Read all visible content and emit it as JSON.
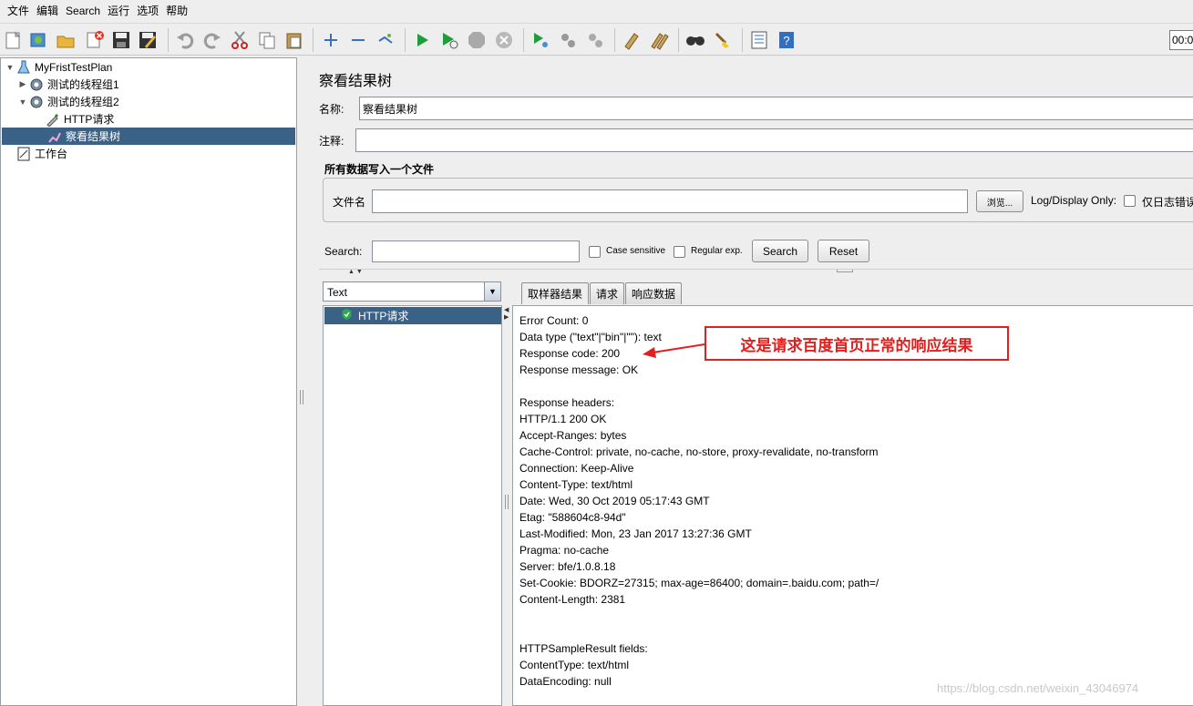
{
  "menu": [
    "文件",
    "编辑",
    "Search",
    "运行",
    "选项",
    "帮助"
  ],
  "toolbar": {
    "icons": [
      "new-icon",
      "templates-icon",
      "open-icon",
      "close-icon",
      "save-icon",
      "save-as-icon",
      "undo-icon",
      "redo-icon",
      "cut-icon",
      "copy-icon",
      "paste-icon",
      "expand-icon",
      "collapse-icon",
      "toggle-icon",
      "start-icon",
      "start-no-pauses-icon",
      "stop-icon",
      "shutdown-icon",
      "remote-start-icon",
      "remote-stop-icon",
      "remote-shutdown-icon",
      "clear-icon",
      "clear-all-icon",
      "search-icon",
      "reset-search-icon",
      "function-helper-icon",
      "help-icon"
    ],
    "timer": "00:0"
  },
  "tree": {
    "plan": "MyFristTestPlan",
    "group1": "测试的线程组1",
    "group2": "测试的线程组2",
    "http": "HTTP请求",
    "listener": "察看结果树",
    "workbench": "工作台"
  },
  "panel": {
    "title": "察看结果树",
    "name_label": "名称:",
    "name_value": "察看结果树",
    "comment_label": "注释:",
    "comment_value": "",
    "file_legend": "所有数据写入一个文件",
    "file_label": "文件名",
    "file_value": "",
    "browse": "浏览...",
    "log_display": "Log/Display Only:",
    "errors_only": "仅日志错误"
  },
  "search": {
    "label": "Search:",
    "value": "",
    "case_sensitive": "Case sensitive",
    "regex": "Regular exp.",
    "search_btn": "Search",
    "reset_btn": "Reset"
  },
  "renderer": {
    "selected": "Text",
    "items": [
      "HTTP请求"
    ]
  },
  "tabs": [
    "取样器结果",
    "请求",
    "响应数据"
  ],
  "response_lines": [
    "Error Count: 0",
    "Data type (\"text\"|\"bin\"|\"\"): text",
    "Response code: 200",
    "Response message: OK",
    "",
    "Response headers:",
    "HTTP/1.1 200 OK",
    "Accept-Ranges: bytes",
    "Cache-Control: private, no-cache, no-store, proxy-revalidate, no-transform",
    "Connection: Keep-Alive",
    "Content-Type: text/html",
    "Date: Wed, 30 Oct 2019 05:17:43 GMT",
    "Etag: \"588604c8-94d\"",
    "Last-Modified: Mon, 23 Jan 2017 13:27:36 GMT",
    "Pragma: no-cache",
    "Server: bfe/1.0.8.18",
    "Set-Cookie: BDORZ=27315; max-age=86400; domain=.baidu.com; path=/",
    "Content-Length: 2381",
    "",
    "",
    "HTTPSampleResult fields:",
    "ContentType: text/html",
    "DataEncoding: null"
  ],
  "annotation": "这是请求百度首页正常的响应结果",
  "watermark": "https://blog.csdn.net/weixin_43046974",
  "colors": {
    "selection": "#3a6186",
    "annotation": "#e0201f"
  }
}
